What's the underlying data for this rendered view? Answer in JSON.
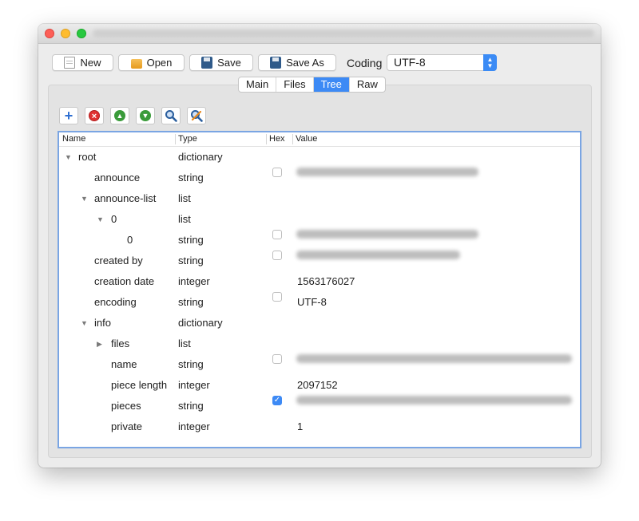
{
  "toolbar": {
    "new_label": "New",
    "open_label": "Open",
    "save_label": "Save",
    "save_as_label": "Save As",
    "coding_label": "Coding",
    "coding_value": "UTF-8"
  },
  "tabs": [
    {
      "label": "Main"
    },
    {
      "label": "Files"
    },
    {
      "label": "Tree"
    },
    {
      "label": "Raw"
    }
  ],
  "active_tab": "Tree",
  "tree_actions": [
    "add-icon",
    "remove-icon",
    "move-up-icon",
    "move-down-icon",
    "search-icon",
    "search-replace-icon"
  ],
  "columns": {
    "name": "Name",
    "type": "Type",
    "hex": "Hex",
    "value": "Value"
  },
  "rows": [
    {
      "name": "root",
      "type": "dictionary",
      "value": "",
      "hex": null,
      "expanded": true
    },
    {
      "name": "announce",
      "type": "string",
      "value": "",
      "hex": false
    },
    {
      "name": "announce-list",
      "type": "list",
      "value": "",
      "hex": null,
      "expanded": true
    },
    {
      "name": "0",
      "type": "list",
      "value": "",
      "hex": null,
      "expanded": true
    },
    {
      "name": "0",
      "type": "string",
      "value": "",
      "hex": false
    },
    {
      "name": "created by",
      "type": "string",
      "value": "",
      "hex": false
    },
    {
      "name": "creation date",
      "type": "integer",
      "value": "1563176027",
      "hex": null
    },
    {
      "name": "encoding",
      "type": "string",
      "value": "UTF-8",
      "hex": false
    },
    {
      "name": "info",
      "type": "dictionary",
      "value": "",
      "hex": null,
      "expanded": true
    },
    {
      "name": "files",
      "type": "list",
      "value": "",
      "hex": null,
      "expanded": false
    },
    {
      "name": "name",
      "type": "string",
      "value": "",
      "hex": false
    },
    {
      "name": "piece length",
      "type": "integer",
      "value": "2097152",
      "hex": null
    },
    {
      "name": "pieces",
      "type": "string",
      "value": "",
      "hex": true
    },
    {
      "name": "private",
      "type": "integer",
      "value": "1",
      "hex": null
    }
  ],
  "colors": {
    "accent": "#3d8af5",
    "tree_border": "#7aa5e3"
  }
}
